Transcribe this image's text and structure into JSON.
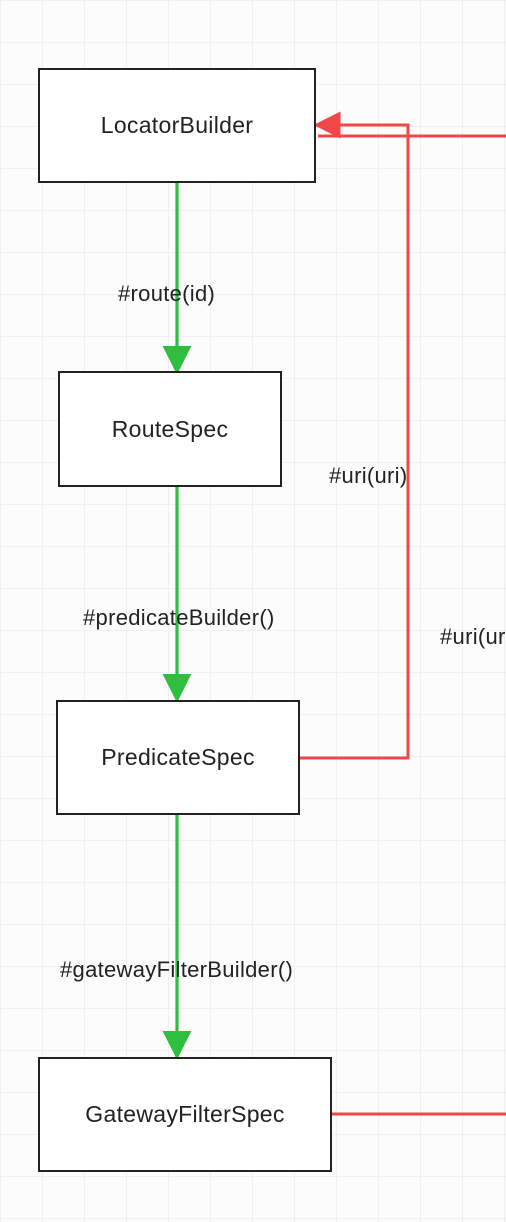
{
  "nodes": {
    "locator_builder": "LocatorBuilder",
    "route_spec": "RouteSpec",
    "predicate_spec": "PredicateSpec",
    "gateway_filter_spec": "GatewayFilterSpec"
  },
  "edges": {
    "route_id": "#route(id)",
    "predicate_builder": "#predicateBuilder()",
    "gateway_filter_builder": "#gatewayFilterBuilder()",
    "uri_uri": "#uri(uri)",
    "uri_ur": "#uri(ur"
  },
  "colors": {
    "green": "#2fbf3f",
    "red": "#f04848",
    "node_border": "#222222"
  }
}
